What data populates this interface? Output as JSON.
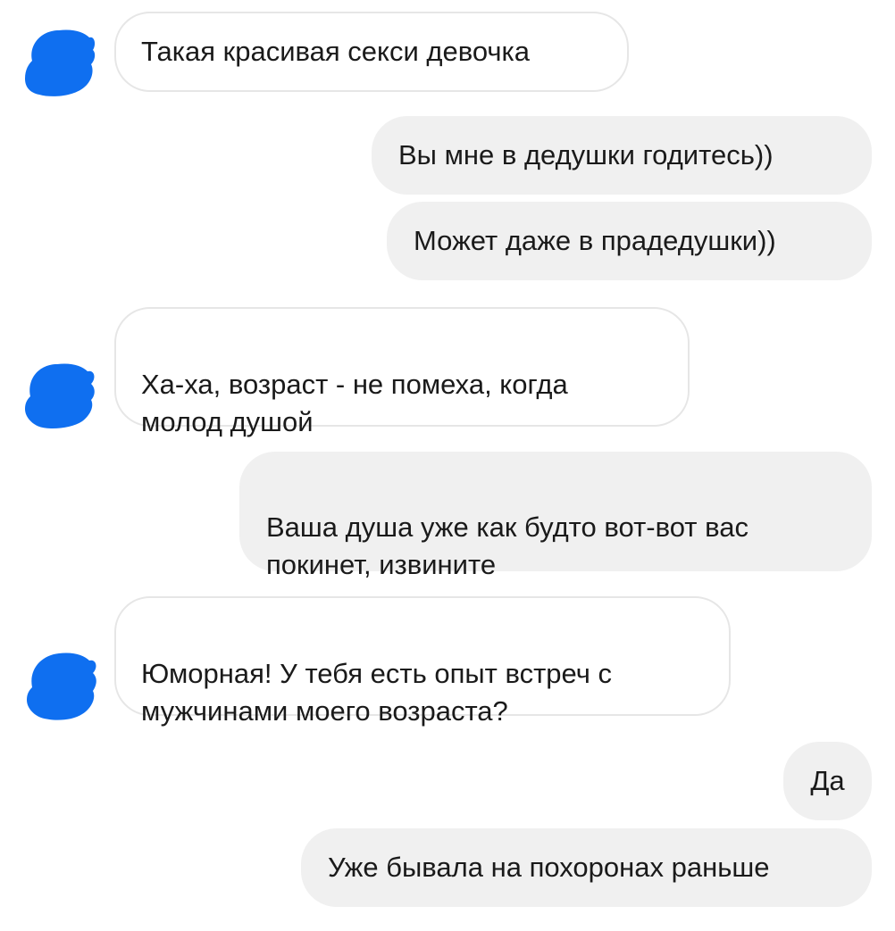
{
  "conversation": {
    "messages": [
      {
        "side": "incoming",
        "text": "Такая красивая секси девочка"
      },
      {
        "side": "outgoing",
        "text": "Вы мне в дедушки годитесь))"
      },
      {
        "side": "outgoing",
        "text": "Может даже в прадедушки))"
      },
      {
        "side": "incoming",
        "text": "Ха-ха, возраст - не помеха, когда\nмолод душой"
      },
      {
        "side": "outgoing",
        "text": "Ваша душа уже как будто вот-вот вас\nпокинет, извините"
      },
      {
        "side": "incoming",
        "text": "Юморная! У тебя есть опыт встреч с\nмужчинами моего возраста?"
      },
      {
        "side": "outgoing",
        "text": "Да"
      },
      {
        "side": "outgoing",
        "text": "Уже бывала на похоронах раньше"
      }
    ],
    "avatar": {
      "icon": "redacted-avatar-icon",
      "color": "#0f6ff0"
    }
  }
}
